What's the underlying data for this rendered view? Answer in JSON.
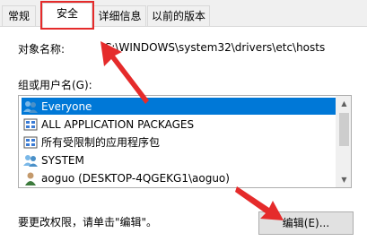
{
  "tabs": [
    {
      "label": "常规"
    },
    {
      "label": "安全"
    },
    {
      "label": "详细信息"
    },
    {
      "label": "以前的版本"
    }
  ],
  "object_name": {
    "label": "对象名称:",
    "value": "C:\\WINDOWS\\system32\\drivers\\etc\\hosts"
  },
  "group_label": "组或用户名(G):",
  "users": [
    {
      "name": "Everyone",
      "icon": "users-group-icon",
      "selected": true
    },
    {
      "name": "ALL APPLICATION PACKAGES",
      "icon": "packages-icon",
      "selected": false
    },
    {
      "name": "所有受限制的应用程序包",
      "icon": "packages-icon",
      "selected": false
    },
    {
      "name": "SYSTEM",
      "icon": "users-group-icon",
      "selected": false
    },
    {
      "name": "aoguo (DESKTOP-4QGEKG1\\aoguo)",
      "icon": "user-icon",
      "selected": false
    }
  ],
  "hint": "要更改权限，请单击\"编辑\"。",
  "edit_button": "编辑(E)...",
  "colors": {
    "selection": "#0078d7",
    "annotation": "#e52b2b"
  }
}
